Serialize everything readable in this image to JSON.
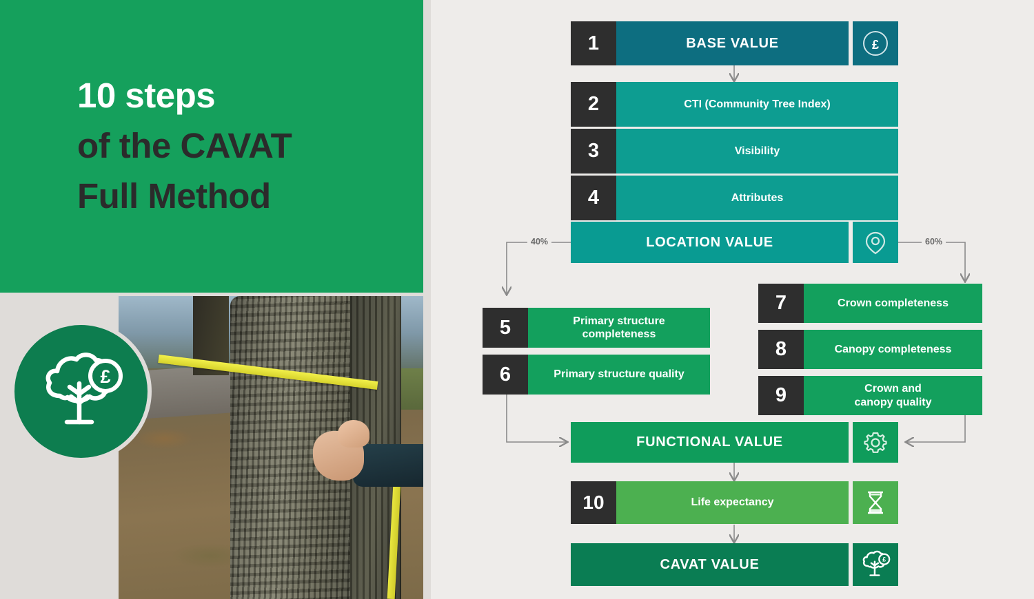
{
  "left": {
    "title_lines": [
      {
        "text": "10 steps",
        "style": "white"
      },
      {
        "text": "of the CAVAT",
        "style": "dark"
      },
      {
        "text": "Full Method",
        "style": "dark"
      }
    ],
    "logo_icon": "tree-with-pound-icon",
    "photo_alt": "person-measuring-tree-trunk-with-tape-measure"
  },
  "flow": {
    "rows": [
      {
        "id": "base-value",
        "number": "1",
        "label": "BASE VALUE",
        "style": "head",
        "color": "c-base",
        "icon": "pound-circle-icon",
        "has_icon": true
      },
      {
        "id": "cti",
        "number": "2",
        "label": "CTI (Community Tree Index)",
        "style": "sub",
        "color": "c-loc",
        "icon": "",
        "has_icon": false
      },
      {
        "id": "visibility",
        "number": "3",
        "label": "Visibility",
        "style": "sub",
        "color": "c-loc",
        "icon": "",
        "has_icon": false
      },
      {
        "id": "attributes",
        "number": "4",
        "label": "Attributes",
        "style": "sub",
        "color": "c-loc",
        "icon": "",
        "has_icon": false
      },
      {
        "id": "location-value",
        "number": "",
        "label": "LOCATION VALUE",
        "style": "head",
        "color": "c-locv",
        "icon": "map-pin-icon",
        "has_icon": true
      },
      {
        "id": "primary-structure-completeness",
        "number": "5",
        "label": "Primary structure\ncompleteness",
        "style": "sub",
        "color": "c-func",
        "icon": "",
        "has_icon": false
      },
      {
        "id": "primary-structure-quality",
        "number": "6",
        "label": "Primary structure quality",
        "style": "sub",
        "color": "c-func",
        "icon": "",
        "has_icon": false
      },
      {
        "id": "crown-completeness",
        "number": "7",
        "label": "Crown completeness",
        "style": "sub",
        "color": "c-func",
        "icon": "",
        "has_icon": false
      },
      {
        "id": "canopy-completeness",
        "number": "8",
        "label": "Canopy completeness",
        "style": "sub",
        "color": "c-func",
        "icon": "",
        "has_icon": false
      },
      {
        "id": "crown-canopy-quality",
        "number": "9",
        "label": "Crown and\ncanopy quality",
        "style": "sub",
        "color": "c-func",
        "icon": "",
        "has_icon": false
      },
      {
        "id": "functional-value",
        "number": "",
        "label": "FUNCTIONAL VALUE",
        "style": "head",
        "color": "c-funcv",
        "icon": "gear-icon",
        "has_icon": true
      },
      {
        "id": "life-expectancy",
        "number": "10",
        "label": "Life expectancy",
        "style": "sub",
        "color": "c-life",
        "icon": "hourglass-icon",
        "has_icon": true
      },
      {
        "id": "cavat-value",
        "number": "",
        "label": "CAVAT VALUE",
        "style": "head",
        "color": "c-cavat",
        "icon": "tree-pound-icon",
        "has_icon": true
      }
    ],
    "split_left_label": "40%",
    "split_right_label": "60%"
  },
  "colors": {
    "brand_green": "#15a05c",
    "deep_teal": "#0d6e80",
    "teal": "#0d9d91",
    "green": "#13a05d",
    "light_green": "#4cb050",
    "dark_green": "#0a7d53",
    "charcoal": "#2e2e2e",
    "background": "#eeecea",
    "connector": "#8a8a8a"
  }
}
